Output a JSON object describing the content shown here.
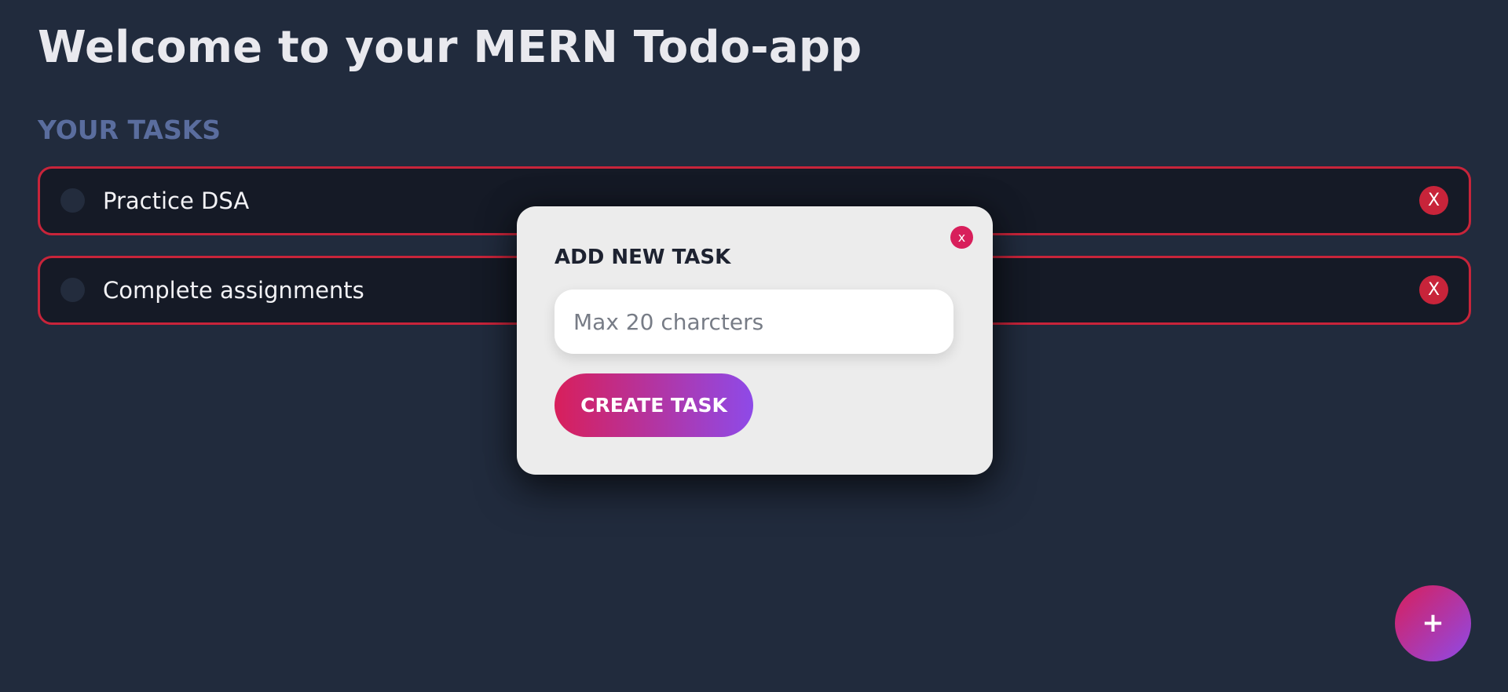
{
  "header": {
    "title": "Welcome to your MERN Todo-app"
  },
  "tasks_section": {
    "heading": "YOUR TASKS",
    "items": [
      {
        "label": "Practice DSA",
        "delete_label": "X"
      },
      {
        "label": "Complete assignments",
        "delete_label": "X"
      }
    ]
  },
  "modal": {
    "close_label": "x",
    "title": "ADD NEW TASK",
    "input_placeholder": "Max 20 charcters",
    "input_value": "",
    "submit_label": "CREATE TASK"
  },
  "fab": {
    "label": "+"
  },
  "colors": {
    "background": "#212b3d",
    "task_background": "#151a26",
    "accent_red": "#c8243a",
    "gradient_start": "#d81f5b",
    "gradient_end": "#8e4ae8",
    "heading_muted": "#5a6d9e"
  }
}
